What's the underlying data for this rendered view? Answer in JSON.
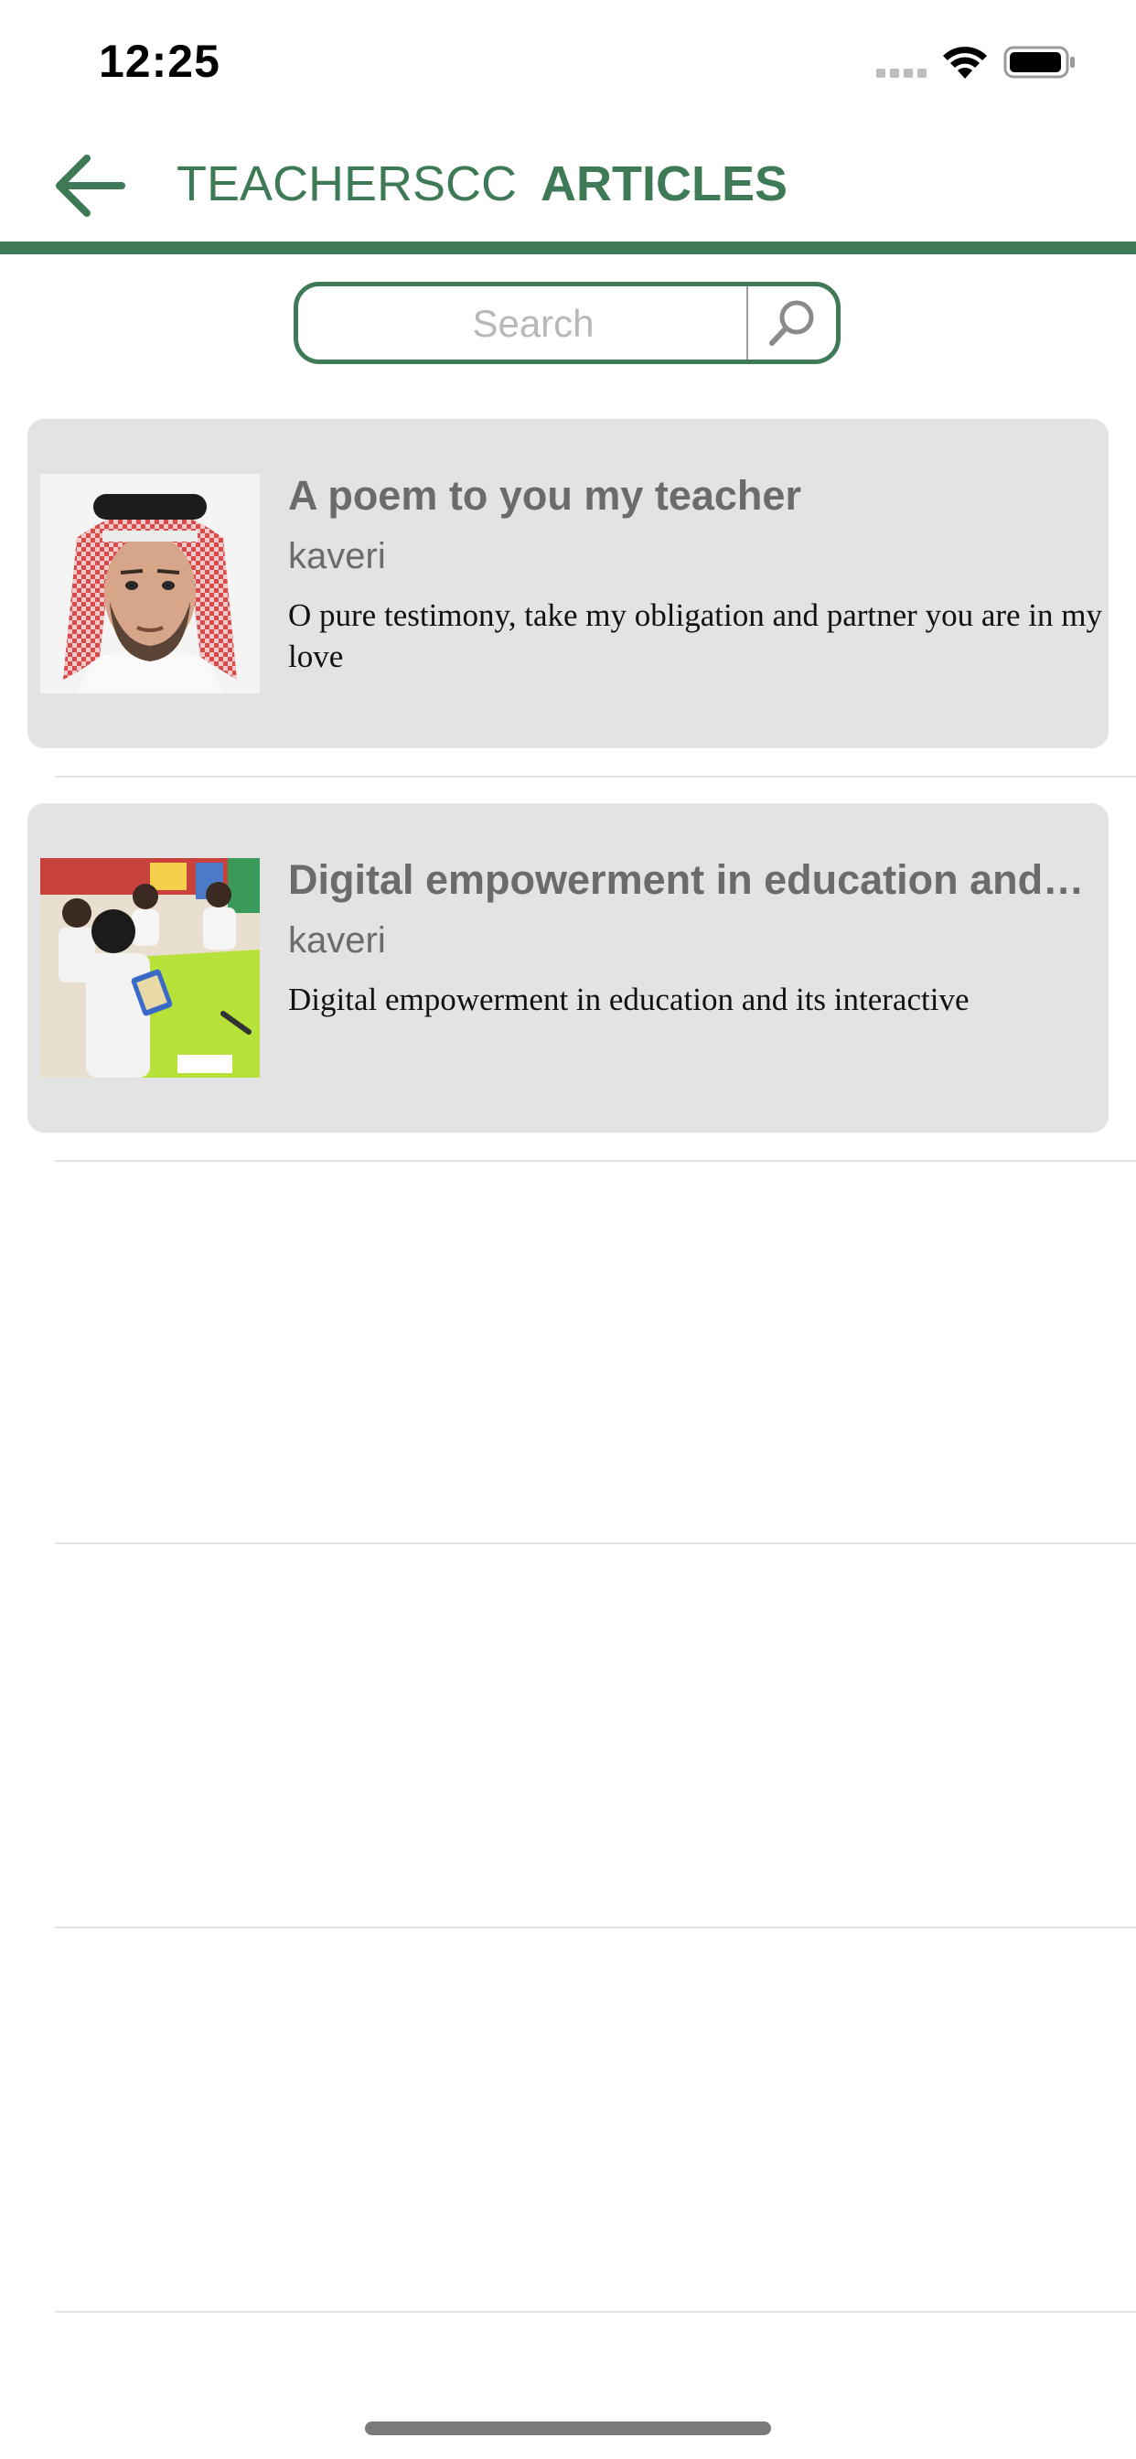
{
  "status_bar": {
    "time": "12:25"
  },
  "nav": {
    "brand": "TEACHERSCC",
    "section": "ARTICLES",
    "accent_color": "#3f7a57"
  },
  "search": {
    "placeholder": "Search",
    "value": ""
  },
  "articles": [
    {
      "title": "A poem to you my teacher",
      "author": "kaveri",
      "excerpt": "O pure testimony, take my obligation and partner you are in my love",
      "thumbnail": "portrait-photo"
    },
    {
      "title": "Digital empowerment in education and its interactive",
      "author": "kaveri",
      "excerpt": "Digital empowerment in education and its interactive",
      "thumbnail": "classroom-photo"
    }
  ]
}
